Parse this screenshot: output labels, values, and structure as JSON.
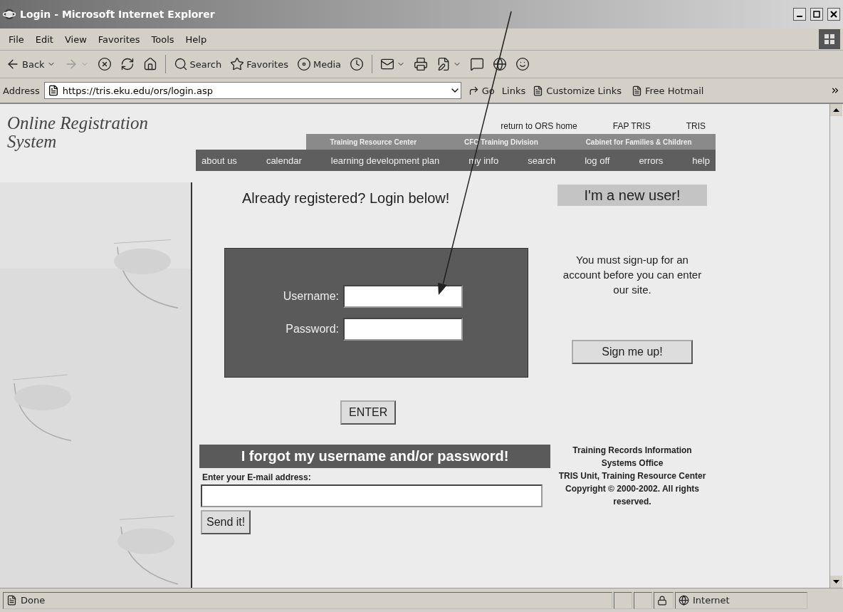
{
  "window": {
    "title": "Login - Microsoft Internet Explorer"
  },
  "menu": [
    "File",
    "Edit",
    "View",
    "Favorites",
    "Tools",
    "Help"
  ],
  "toolbar": [
    {
      "kind": "back",
      "label": "Back",
      "dropdown": true,
      "disabled": false
    },
    {
      "kind": "forward",
      "dropdown": true,
      "disabled": true
    },
    {
      "kind": "stop",
      "dropdown": false,
      "disabled": false
    },
    {
      "kind": "refresh",
      "dropdown": false,
      "disabled": false
    },
    {
      "kind": "home",
      "dropdown": false,
      "disabled": false
    },
    {
      "kind": "separator"
    },
    {
      "kind": "search",
      "label": "Search",
      "dropdown": false,
      "disabled": false
    },
    {
      "kind": "favorites",
      "label": "Favorites",
      "dropdown": false,
      "disabled": false
    },
    {
      "kind": "media",
      "label": "Media",
      "dropdown": false,
      "disabled": false
    },
    {
      "kind": "history",
      "dropdown": false,
      "disabled": false
    },
    {
      "kind": "separator"
    },
    {
      "kind": "mail",
      "dropdown": true,
      "disabled": false
    },
    {
      "kind": "print",
      "dropdown": false,
      "disabled": false
    },
    {
      "kind": "edit",
      "dropdown": true,
      "disabled": false
    },
    {
      "kind": "discuss",
      "dropdown": false,
      "disabled": false
    },
    {
      "kind": "research",
      "dropdown": false,
      "disabled": false
    },
    {
      "kind": "messenger",
      "dropdown": false,
      "disabled": false
    }
  ],
  "address": {
    "label": "Address",
    "url": "https://tris.eku.edu/ors/login.asp",
    "go": "Go",
    "links_label": "Links",
    "links": [
      "Customize Links",
      "Free Hotmail"
    ]
  },
  "site": {
    "logo": [
      "Online Registration",
      "System"
    ],
    "top_links": [
      "return to ORS home",
      "FAP TRIS",
      "TRIS"
    ],
    "org_links": [
      "Training Resource Center",
      "CFC Training Division",
      "Cabinet for Families & Children"
    ],
    "nav": [
      "about us",
      "calendar",
      "learning development plan",
      "my info",
      "search",
      "log off",
      "errors",
      "help"
    ]
  },
  "login": {
    "heading": "Already registered? Login below!",
    "fields": [
      {
        "label": "Username:"
      },
      {
        "label": "Password:"
      }
    ],
    "button": "ENTER"
  },
  "new_user": {
    "heading": "I'm a new user!",
    "message": "You must sign-up for an account before you can enter our site.",
    "button": "Sign me up!"
  },
  "forgot": {
    "heading": "I forgot my username and/or password!",
    "email_label": "Enter your E-mail address:",
    "button": "Send it!"
  },
  "footer": [
    "Training Records Information Systems Office",
    "TRIS Unit, Training Resource Center",
    "Copyright © 2000-2002. All rights reserved."
  ],
  "status": {
    "text": "Done",
    "zone": "Internet"
  }
}
